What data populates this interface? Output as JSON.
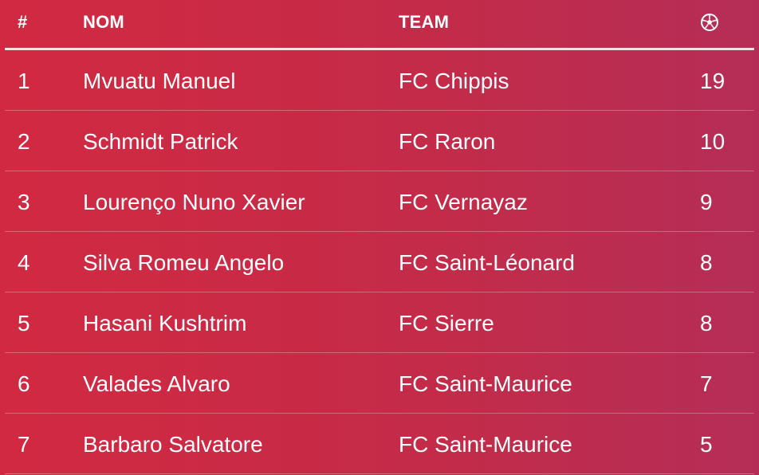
{
  "table": {
    "headers": {
      "rank": "#",
      "name": "NOM",
      "team": "TEAM",
      "goals_icon": "soccer-ball-icon"
    },
    "rows": [
      {
        "rank": "1",
        "name": "Mvuatu Manuel",
        "team": "FC Chippis",
        "goals": "19"
      },
      {
        "rank": "2",
        "name": "Schmidt Patrick",
        "team": "FC Raron",
        "goals": "10"
      },
      {
        "rank": "3",
        "name": "Lourenço Nuno Xavier",
        "team": "FC Vernayaz",
        "goals": "9"
      },
      {
        "rank": "4",
        "name": "Silva Romeu Angelo",
        "team": "FC Saint-Léonard",
        "goals": "8"
      },
      {
        "rank": "5",
        "name": "Hasani Kushtrim",
        "team": "FC Sierre",
        "goals": "8"
      },
      {
        "rank": "6",
        "name": "Valades Alvaro",
        "team": "FC Saint-Maurice",
        "goals": "7"
      },
      {
        "rank": "7",
        "name": "Barbaro Salvatore",
        "team": "FC Saint-Maurice",
        "goals": "5"
      }
    ]
  },
  "colors": {
    "background_start": "#d22942",
    "background_end": "#b52d57",
    "text": "#ffffff"
  }
}
